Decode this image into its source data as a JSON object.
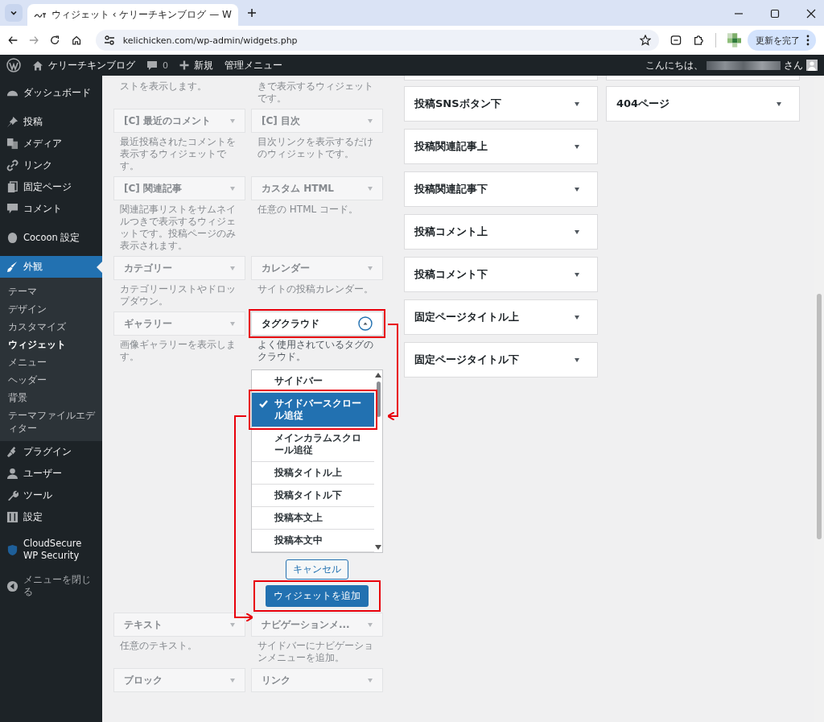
{
  "browser": {
    "tab_title": "ウィジェット ‹ ケリーチキンブログ — W",
    "url": "kelichicken.com/wp-admin/widgets.php",
    "update_button": "更新を完了"
  },
  "admin_bar": {
    "site_name": "ケリーチキンブログ",
    "comment_count": "0",
    "new_label": "新規",
    "admin_menu": "管理メニュー",
    "greeting": "こんにちは、",
    "honorific": "さん"
  },
  "sidebar": {
    "groups": [
      [
        {
          "label": "ダッシュボード",
          "selected": false
        }
      ],
      [
        {
          "label": "投稿",
          "selected": false
        },
        {
          "label": "メディア",
          "selected": false
        },
        {
          "label": "リンク",
          "selected": false
        },
        {
          "label": "固定ページ",
          "selected": false
        },
        {
          "label": "コメント",
          "selected": false
        }
      ],
      [
        {
          "label": "Cocoon 設定",
          "selected": false
        }
      ],
      [
        {
          "label": "外観",
          "selected": true,
          "children": [
            {
              "label": "テーマ",
              "selected": false
            },
            {
              "label": "デザイン",
              "selected": false
            },
            {
              "label": "カスタマイズ",
              "selected": false
            },
            {
              "label": "ウィジェット",
              "selected": true
            },
            {
              "label": "メニュー",
              "selected": false
            },
            {
              "label": "ヘッダー",
              "selected": false
            },
            {
              "label": "背景",
              "selected": false
            },
            {
              "label": "テーマファイルエディター",
              "selected": false
            }
          ]
        },
        {
          "label": "プラグイン",
          "selected": false
        },
        {
          "label": "ユーザー",
          "selected": false
        },
        {
          "label": "ツール",
          "selected": false
        },
        {
          "label": "設定",
          "selected": false
        }
      ],
      [
        {
          "label": "CloudSecure WP Security",
          "selected": false
        }
      ]
    ],
    "collapse": "メニューを閉じる"
  },
  "available_widgets": [
    {
      "description": "ストを表示します。",
      "expanded": false
    },
    {
      "description": "きで表示するウィジェットです。",
      "expanded": false
    },
    {
      "title": "[C] 最近のコメント",
      "description": "最近投稿されたコメントを表示するウィジェットです。",
      "expanded": false
    },
    {
      "title": "[C] 目次",
      "description": "目次リンクを表示するだけのウィジェットです。",
      "expanded": false
    },
    {
      "title": "[C] 関連記事",
      "description": "関連記事リストをサムネイルつきで表示するウィジェットです。投稿ページのみ表示されます。",
      "expanded": false
    },
    {
      "title": "カスタム HTML",
      "description": "任意の HTML コード。",
      "expanded": false
    },
    {
      "title": "カテゴリー",
      "description": "カテゴリーリストやドロップダウン。",
      "expanded": false
    },
    {
      "title": "カレンダー",
      "description": "サイトの投稿カレンダー。",
      "expanded": false
    },
    {
      "title": "ギャラリー",
      "description": "画像ギャラリーを表示します。",
      "expanded": false
    },
    {
      "title": "タグクラウド",
      "description": "よく使用されているタグのクラウド。",
      "expanded": true,
      "chooser": {
        "options": [
          {
            "label": "サイドバー",
            "selected": false
          },
          {
            "label": "サイドバースクロール追従",
            "selected": true
          },
          {
            "label": "メインカラムスクロール追従",
            "selected": false
          },
          {
            "label": "投稿タイトル上",
            "selected": false
          },
          {
            "label": "投稿タイトル下",
            "selected": false
          },
          {
            "label": "投稿本文上",
            "selected": false
          },
          {
            "label": "投稿本文中",
            "selected": false
          }
        ],
        "cancel": "キャンセル",
        "add": "ウィジェットを追加"
      }
    },
    {
      "title": "テキスト",
      "description": "任意のテキスト。",
      "expanded": false
    },
    {
      "title": "ナビゲーションメ...",
      "description": "サイドバーにナビゲーションメニューを追加。",
      "expanded": false
    },
    {
      "title": "ブロック",
      "expanded": false
    },
    {
      "title": "リンク",
      "expanded": false
    }
  ],
  "sidebars": [
    [
      {
        "title": "投稿SNSボタン下"
      },
      {
        "title": "投稿関連記事上"
      },
      {
        "title": "投稿関連記事下"
      },
      {
        "title": "投稿コメント上"
      },
      {
        "title": "投稿コメント下"
      },
      {
        "title": "固定ページタイトル上"
      },
      {
        "title": "固定ページタイトル下"
      }
    ],
    [
      {
        "title": "404ページ"
      }
    ]
  ]
}
